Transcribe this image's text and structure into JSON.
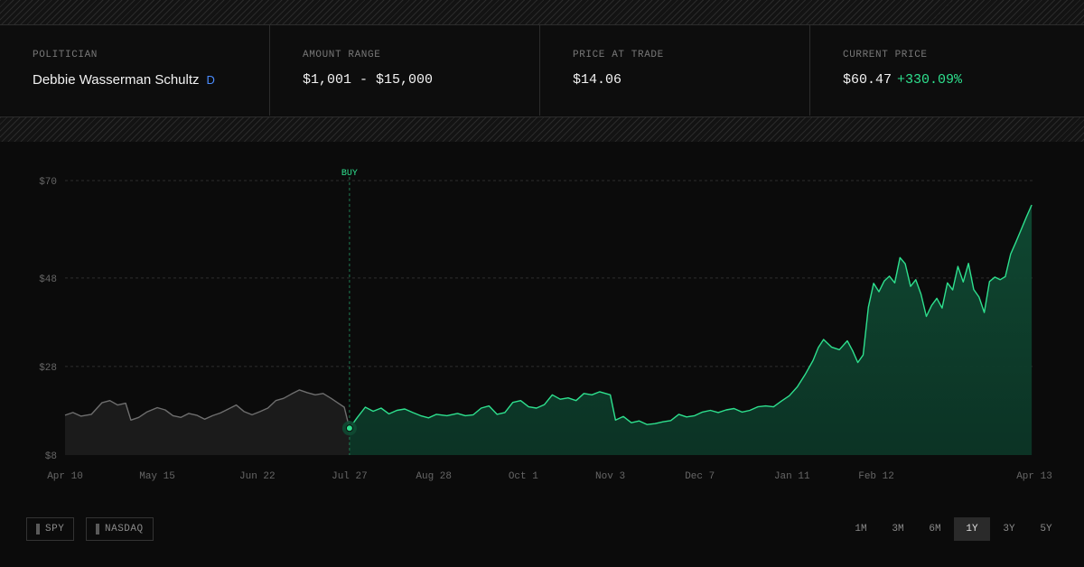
{
  "stats": {
    "politician": {
      "label": "POLITICIAN",
      "value": "Debbie Wasserman Schultz",
      "party": "D"
    },
    "amount": {
      "label": "AMOUNT RANGE",
      "value": "$1,001 - $15,000"
    },
    "price_at_trade": {
      "label": "PRICE AT TRADE",
      "value": "$14.06"
    },
    "current_price": {
      "label": "CURRENT PRICE",
      "value": "$60.47",
      "change": "+330.09%"
    }
  },
  "benchmarks": [
    "SPY",
    "NASDAQ"
  ],
  "ranges": [
    "1M",
    "3M",
    "6M",
    "1Y",
    "3Y",
    "5Y"
  ],
  "active_range": "1Y",
  "colors": {
    "accent": "#2ee08e",
    "party": "#4a8cff",
    "pre_buy_line": "#6e6e6e"
  },
  "chart_data": {
    "type": "area",
    "ylim": [
      8,
      70
    ],
    "y_ticks": [
      8,
      28,
      48,
      70
    ],
    "y_tick_labels": [
      "$8",
      "$28",
      "$48",
      "$70"
    ],
    "x_tick_labels": [
      "Apr 10",
      "May 15",
      "Jun 22",
      "Jul 27",
      "Aug 28",
      "Oct 1",
      "Nov 3",
      "Dec 7",
      "Jan 11",
      "Feb 12",
      "Apr 13"
    ],
    "x_tick_days": [
      0,
      35,
      73,
      108,
      140,
      174,
      207,
      241,
      276,
      308,
      368
    ],
    "x_range_days": [
      0,
      368
    ],
    "buy_label": "BUY",
    "buy_day": 108,
    "buy_price": 14.06,
    "grid": "horizontal dashed",
    "series": [
      {
        "segment": "pre-buy",
        "points": [
          [
            0,
            17
          ],
          [
            3,
            17.6
          ],
          [
            6,
            16.8
          ],
          [
            10,
            17.2
          ],
          [
            14,
            19.8
          ],
          [
            17,
            20.3
          ],
          [
            20,
            19.3
          ],
          [
            23,
            19.7
          ],
          [
            25,
            15.9
          ],
          [
            28,
            16.5
          ],
          [
            31,
            17.7
          ],
          [
            35,
            18.7
          ],
          [
            38,
            18.2
          ],
          [
            41,
            16.9
          ],
          [
            44,
            16.5
          ],
          [
            47,
            17.4
          ],
          [
            50,
            17
          ],
          [
            53,
            16.1
          ],
          [
            56,
            16.9
          ],
          [
            59,
            17.5
          ],
          [
            62,
            18.4
          ],
          [
            65,
            19.3
          ],
          [
            68,
            17.8
          ],
          [
            71,
            17.1
          ],
          [
            74,
            17.8
          ],
          [
            77,
            18.6
          ],
          [
            80,
            20.3
          ],
          [
            83,
            20.8
          ],
          [
            86,
            21.8
          ],
          [
            89,
            22.7
          ],
          [
            92,
            22.1
          ],
          [
            95,
            21.6
          ],
          [
            98,
            21.9
          ],
          [
            101,
            20.8
          ],
          [
            104,
            19.6
          ],
          [
            106,
            18.8
          ],
          [
            108,
            14.06
          ]
        ]
      },
      {
        "segment": "post-buy",
        "points": [
          [
            108,
            14.06
          ],
          [
            111,
            16.5
          ],
          [
            114,
            18.8
          ],
          [
            117,
            17.9
          ],
          [
            120,
            18.6
          ],
          [
            123,
            17.3
          ],
          [
            126,
            18.1
          ],
          [
            129,
            18.4
          ],
          [
            132,
            17.6
          ],
          [
            135,
            16.9
          ],
          [
            138,
            16.4
          ],
          [
            141,
            17.2
          ],
          [
            145,
            16.9
          ],
          [
            149,
            17.4
          ],
          [
            152,
            16.9
          ],
          [
            155,
            17.1
          ],
          [
            158,
            18.6
          ],
          [
            161,
            19.1
          ],
          [
            164,
            17.2
          ],
          [
            167,
            17.6
          ],
          [
            170,
            19.9
          ],
          [
            173,
            20.3
          ],
          [
            176,
            18.9
          ],
          [
            179,
            18.6
          ],
          [
            182,
            19.4
          ],
          [
            185,
            21.6
          ],
          [
            188,
            20.6
          ],
          [
            191,
            20.9
          ],
          [
            194,
            20.3
          ],
          [
            197,
            21.9
          ],
          [
            200,
            21.6
          ],
          [
            203,
            22.3
          ],
          [
            207,
            21.6
          ],
          [
            209,
            15.9
          ],
          [
            212,
            16.7
          ],
          [
            215,
            15.3
          ],
          [
            218,
            15.7
          ],
          [
            221,
            14.9
          ],
          [
            224,
            15.1
          ],
          [
            227,
            15.5
          ],
          [
            230,
            15.8
          ],
          [
            233,
            17.2
          ],
          [
            236,
            16.6
          ],
          [
            239,
            16.9
          ],
          [
            242,
            17.7
          ],
          [
            245,
            18.1
          ],
          [
            248,
            17.6
          ],
          [
            251,
            18.2
          ],
          [
            254,
            18.5
          ],
          [
            257,
            17.7
          ],
          [
            260,
            18.1
          ],
          [
            263,
            18.9
          ],
          [
            266,
            19.1
          ],
          [
            269,
            18.9
          ],
          [
            272,
            20.2
          ],
          [
            275,
            21.4
          ],
          [
            278,
            23.4
          ],
          [
            281,
            26.2
          ],
          [
            284,
            29.4
          ],
          [
            286,
            32.3
          ],
          [
            288,
            34.1
          ],
          [
            291,
            32.4
          ],
          [
            294,
            31.8
          ],
          [
            297,
            33.8
          ],
          [
            299,
            31.6
          ],
          [
            301,
            28.9
          ],
          [
            303,
            30.6
          ],
          [
            305,
            41.4
          ],
          [
            307,
            46.8
          ],
          [
            309,
            44.9
          ],
          [
            311,
            47.3
          ],
          [
            313,
            48.4
          ],
          [
            315,
            46.9
          ],
          [
            317,
            52.6
          ],
          [
            319,
            51.2
          ],
          [
            321,
            46.1
          ],
          [
            323,
            47.6
          ],
          [
            325,
            44.3
          ],
          [
            327,
            39.3
          ],
          [
            329,
            41.8
          ],
          [
            331,
            43.4
          ],
          [
            333,
            41.2
          ],
          [
            335,
            46.9
          ],
          [
            337,
            45.3
          ],
          [
            339,
            50.6
          ],
          [
            341,
            47.1
          ],
          [
            343,
            51.3
          ],
          [
            345,
            45.4
          ],
          [
            347,
            43.7
          ],
          [
            349,
            40.2
          ],
          [
            351,
            47.2
          ],
          [
            353,
            48.2
          ],
          [
            355,
            47.6
          ],
          [
            357,
            48.3
          ],
          [
            359,
            53.4
          ],
          [
            361,
            56.1
          ],
          [
            363,
            58.9
          ],
          [
            365,
            61.8
          ],
          [
            367,
            64.5
          ]
        ]
      }
    ]
  }
}
